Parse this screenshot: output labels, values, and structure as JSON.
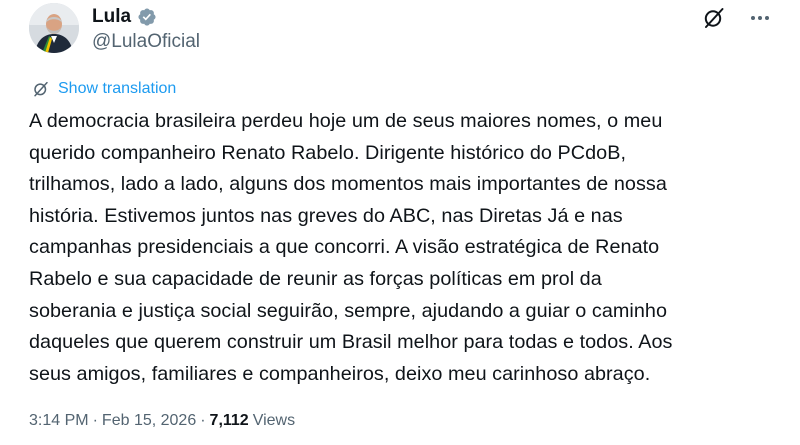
{
  "author": {
    "name": "Lula",
    "handle": "@LulaOficial"
  },
  "translate": {
    "label": "Show translation"
  },
  "post": {
    "text": "A democracia brasileira perdeu hoje um de seus maiores nomes, o meu\nquerido companheiro Renato Rabelo. Dirigente histórico do PCdoB,\ntrilhamos, lado a lado, alguns dos momentos mais importantes de nossa\nhistória. Estivemos juntos nas greves do ABC, nas Diretas Já e nas\ncampanhas presidenciais a que concorri. A visão estratégica de Renato\nRabelo e sua capacidade de reunir as forças políticas em prol da\nsoberania e justiça social seguirão, sempre, ajudando a guiar o caminho\ndaqueles que querem construir um Brasil melhor para todas e todos. Aos\nseus amigos, familiares e companheiros, deixo meu carinhoso abraço."
  },
  "meta": {
    "time": "3:14 PM",
    "separator": "·",
    "date": "Feb 15, 2026",
    "views_count": "7,112",
    "views_label": "Views"
  },
  "icons": {
    "verified": "verified-badge-icon",
    "grok": "grok-icon",
    "more": "more-icon",
    "translate": "translate-icon"
  },
  "colors": {
    "accent": "#1d9bf0",
    "verified_badge": "#829aab",
    "text": "#0f1419",
    "secondary": "#536471"
  }
}
